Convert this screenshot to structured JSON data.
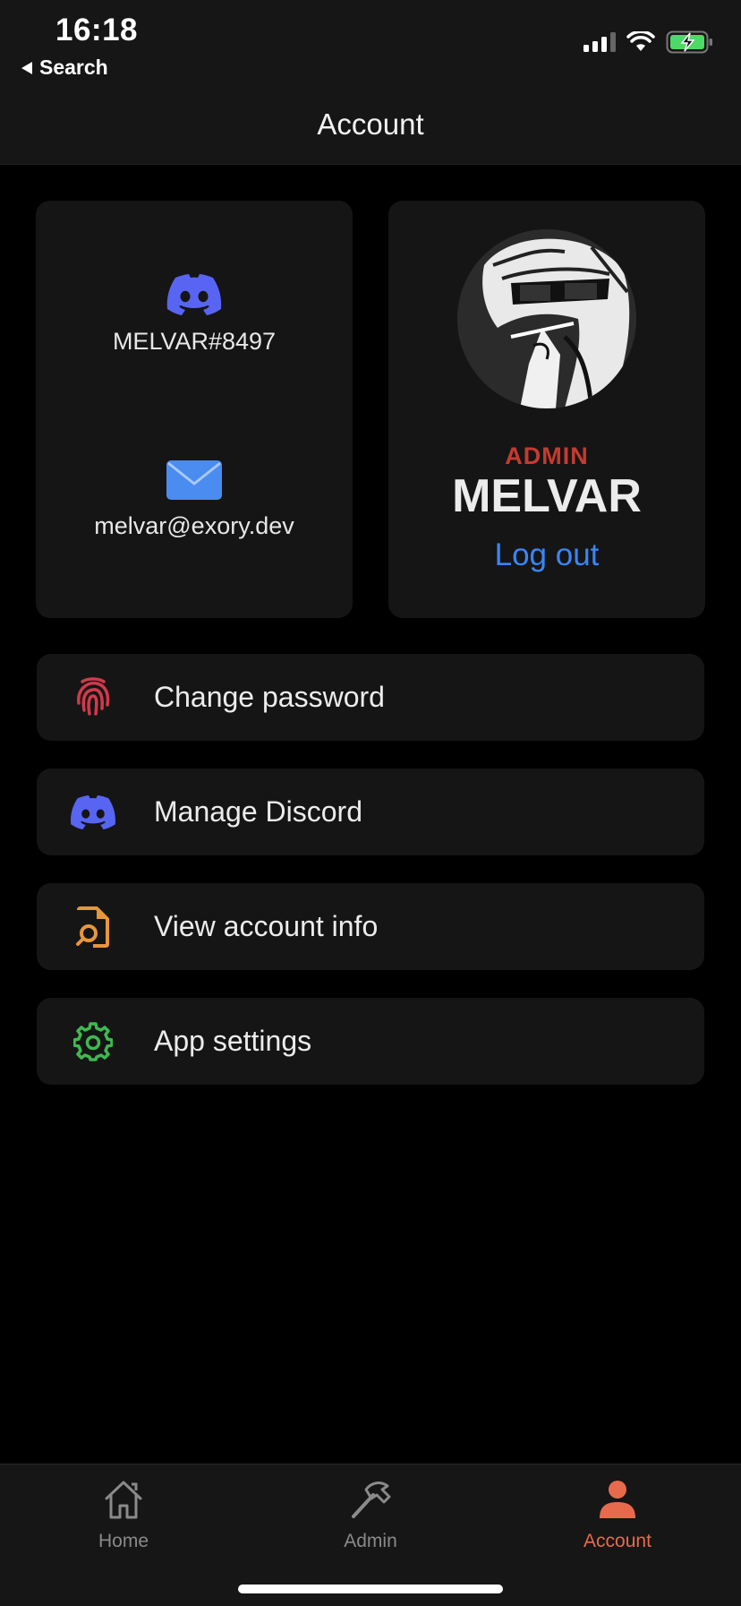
{
  "status_bar": {
    "time": "16:18",
    "back_label": "Search"
  },
  "header": {
    "title": "Account"
  },
  "contact_card": {
    "discord_icon": "discord-icon",
    "discord_tag": "MELVAR#8497",
    "email_icon": "mail-icon",
    "email": "melvar@exory.dev"
  },
  "profile_card": {
    "role": "ADMIN",
    "username": "MELVAR",
    "logout_label": "Log out"
  },
  "menu": {
    "items": [
      {
        "label": "Change password",
        "icon": "fingerprint-icon"
      },
      {
        "label": "Manage Discord",
        "icon": "discord-icon"
      },
      {
        "label": "View account info",
        "icon": "document-search-icon"
      },
      {
        "label": "App settings",
        "icon": "gear-icon"
      }
    ]
  },
  "tabbar": {
    "tabs": [
      {
        "label": "Home",
        "icon": "home-icon"
      },
      {
        "label": "Admin",
        "icon": "hammer-icon"
      },
      {
        "label": "Account",
        "icon": "person-icon"
      }
    ],
    "active": "Account"
  },
  "colors": {
    "accent": "#e86a4c",
    "link": "#3a86f5",
    "role": "#c63a2f",
    "discord": "#5865f2",
    "fingerprint": "#d23a4a",
    "doc": "#e8963a",
    "gear": "#3fb950"
  }
}
